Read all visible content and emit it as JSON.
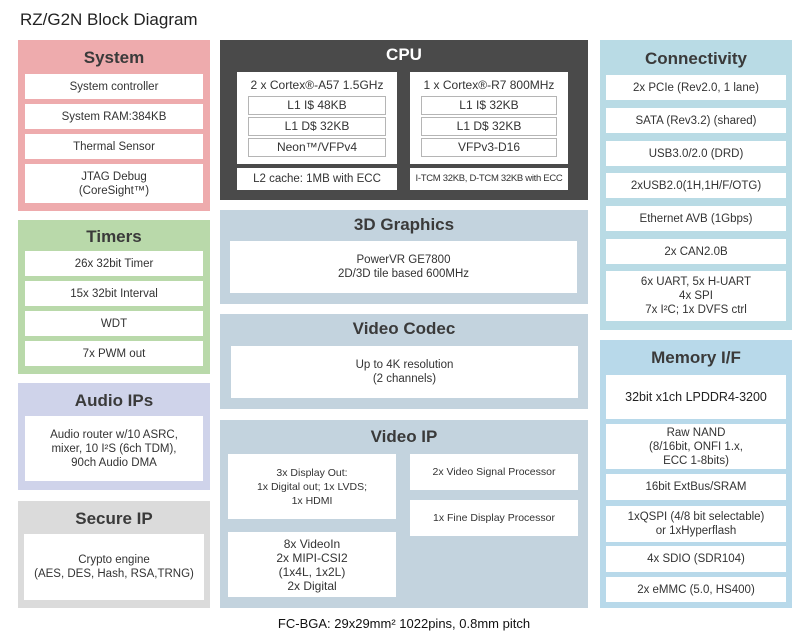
{
  "title": "RZ/G2N Block Diagram",
  "footer": "FC-BGA: 29x29mm² 1022pins, 0.8mm pitch",
  "colors": {
    "system": "#eeabad",
    "timers": "#b9d9aa",
    "audio": "#cfd3ea",
    "secure": "#dbdbdb",
    "cpu": "#4a4a4a",
    "graphics_video": "#c3d3de",
    "connectivity": "#b9dbe5",
    "memory": "#b8d9ea"
  },
  "system": {
    "title": "System",
    "items": [
      "System controller",
      "System RAM:384KB",
      "Thermal Sensor",
      "JTAG Debug\n(CoreSight™)"
    ]
  },
  "timers": {
    "title": "Timers",
    "items": [
      "26x 32bit Timer",
      "15x 32bit Interval",
      "WDT",
      "7x PWM out"
    ]
  },
  "audio": {
    "title": "Audio IPs",
    "items": [
      "Audio router w/10 ASRC,\nmixer, 10 I²S (6ch TDM),\n90ch Audio DMA"
    ]
  },
  "secure": {
    "title": "Secure IP",
    "items": [
      "Crypto engine\n(AES, DES, Hash, RSA,TRNG)"
    ]
  },
  "cpu": {
    "title": "CPU",
    "a57": {
      "header": "2 x Cortex®-A57 1.5GHz",
      "rows": [
        "L1 I$ 48KB",
        "L1 D$ 32KB",
        "Neon™/VFPv4"
      ],
      "bottom": "L2 cache: 1MB with ECC"
    },
    "r7": {
      "header": "1 x Cortex®-R7 800MHz",
      "rows": [
        "L1 I$ 32KB",
        "L1 D$ 32KB",
        "VFPv3-D16"
      ],
      "bottom": "I-TCM 32KB, D-TCM 32KB with ECC"
    }
  },
  "graphics": {
    "title": "3D Graphics",
    "items": [
      "PowerVR GE7800\n2D/3D tile based 600MHz"
    ]
  },
  "codec": {
    "title": "Video Codec",
    "items": [
      "Up to 4K resolution\n(2 channels)"
    ]
  },
  "video_ip": {
    "title": "Video IP",
    "items": [
      "3x Display Out:\n1x Digital out; 1x LVDS;\n1x HDMI",
      "8x VideoIn\n2x MIPI-CSI2\n(1x4L, 1x2L)\n2x Digital",
      "2x Video Signal Processor",
      "1x Fine Display Processor"
    ]
  },
  "connectivity": {
    "title": "Connectivity",
    "items": [
      "2x PCIe (Rev2.0, 1 lane)",
      "SATA (Rev3.2) (shared)",
      "USB3.0/2.0 (DRD)",
      "2xUSB2.0(1H,1H/F/OTG)",
      "Ethernet AVB (1Gbps)",
      "2x CAN2.0B",
      "6x UART, 5x H-UART\n4x SPI\n7x I²C; 1x DVFS ctrl"
    ]
  },
  "memory": {
    "title": "Memory I/F",
    "items": [
      "32bit x1ch LPDDR4-3200",
      "Raw NAND\n(8/16bit, ONFI 1.x,\nECC 1-8bits)",
      "16bit ExtBus/SRAM",
      "1xQSPI (4/8 bit selectable)\nor 1xHyperflash",
      "4x SDIO (SDR104)",
      "2x eMMC (5.0, HS400)"
    ]
  }
}
